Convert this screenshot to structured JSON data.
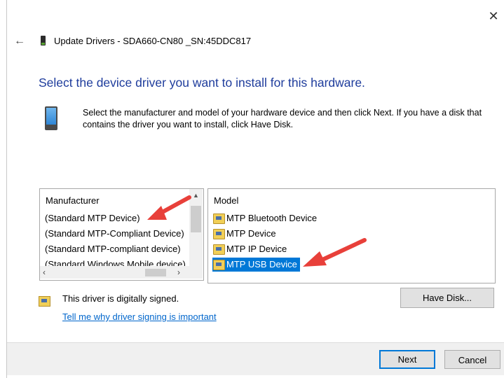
{
  "window": {
    "title": "Update Drivers - SDA660-CN80 _SN:45DDC817",
    "close_glyph": "✕",
    "back_glyph": "←"
  },
  "heading": "Select the device driver you want to install for this hardware.",
  "description": "Select the manufacturer and model of your hardware device and then click Next. If you have a disk that contains the driver you want to install, click Have Disk.",
  "manufacturer": {
    "header": "Manufacturer",
    "items": [
      "(Standard MTP Device)",
      "(Standard MTP-Compliant Device)",
      "(Standard MTP-compliant device)",
      "(Standard Windows Mobile device)"
    ]
  },
  "model": {
    "header": "Model",
    "items": [
      "MTP Bluetooth Device",
      "MTP Device",
      "MTP IP Device",
      "MTP USB Device"
    ],
    "selected_index": 3
  },
  "signing": {
    "status": "This driver is digitally signed.",
    "link": "Tell me why driver signing is important"
  },
  "buttons": {
    "have_disk": "Have Disk...",
    "next": "Next",
    "cancel": "Cancel"
  },
  "colors": {
    "heading": "#1e3c9c",
    "selection": "#0078d7",
    "annotation_arrow": "#e8403a",
    "link": "#0066cc"
  }
}
